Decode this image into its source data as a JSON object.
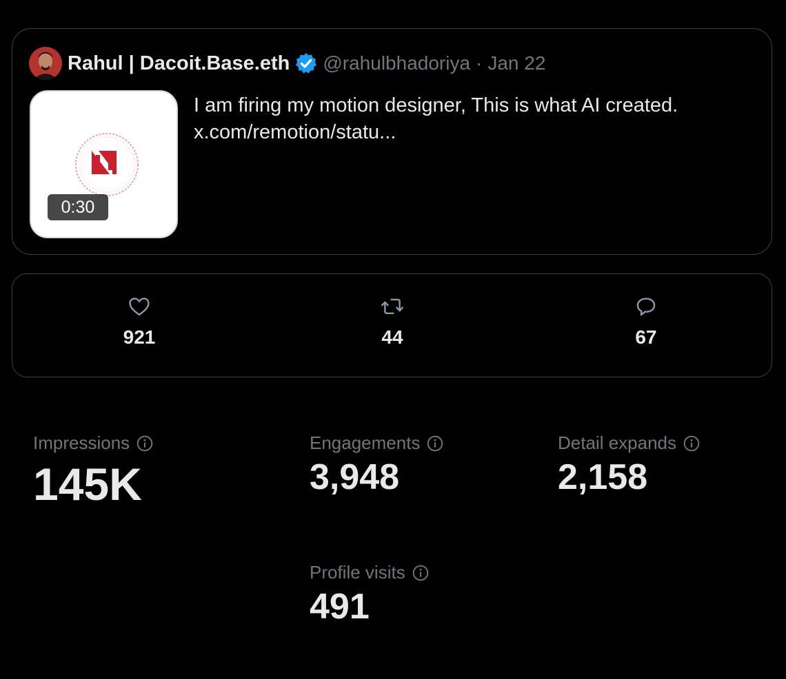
{
  "tweet": {
    "author_name": "Rahul | Dacoit.Base.eth",
    "handle": "@rahulbhadoriya",
    "separator": "·",
    "date": "Jan 22",
    "text_line1": "I am firing my motion designer, This is what AI created.",
    "text_line2": "x.com/remotion/statu...",
    "media": {
      "duration": "0:30",
      "logo_icon": "news-logo-icon"
    },
    "colors": {
      "verified": "#1d9bf0",
      "logo_red": "#c8202f"
    }
  },
  "actions": {
    "likes": {
      "icon": "heart-icon",
      "count": "921"
    },
    "reposts": {
      "icon": "repost-icon",
      "count": "44"
    },
    "replies": {
      "icon": "reply-icon",
      "count": "67"
    }
  },
  "metrics": {
    "impressions": {
      "label": "Impressions",
      "value": "145K"
    },
    "engagements": {
      "label": "Engagements",
      "value": "3,948"
    },
    "detail_expands": {
      "label": "Detail expands",
      "value": "2,158"
    },
    "profile_visits": {
      "label": "Profile visits",
      "value": "491"
    }
  }
}
